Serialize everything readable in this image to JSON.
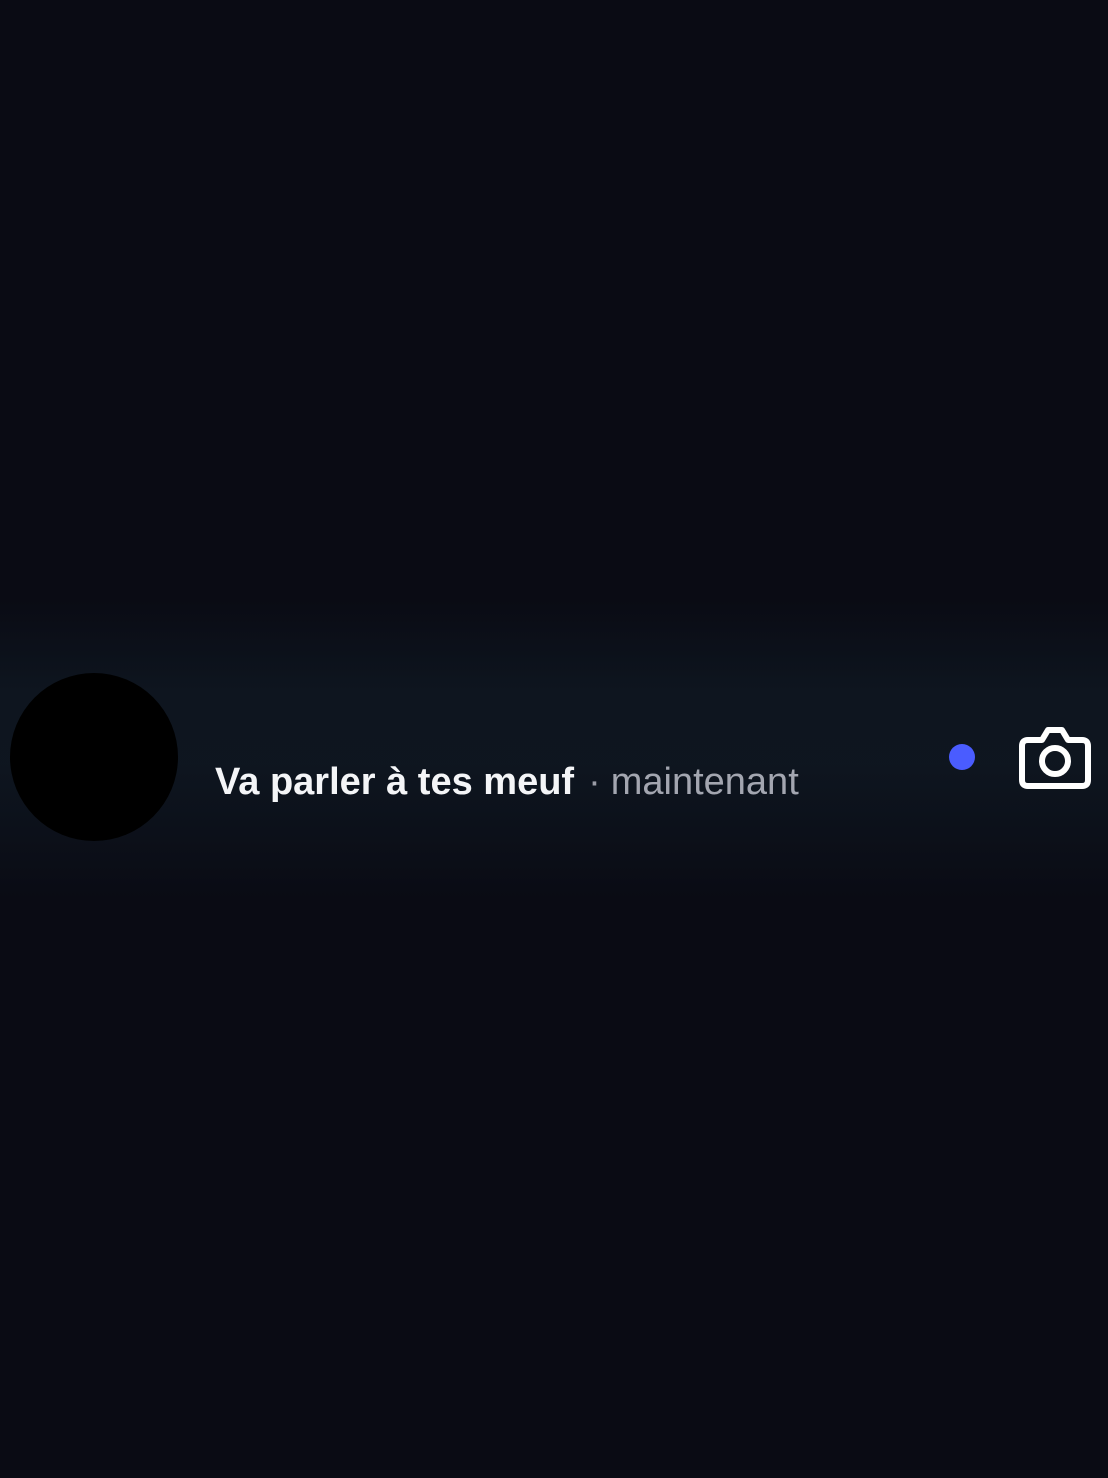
{
  "conversation": {
    "message_preview": "Va parler à tes meuf",
    "separator": "·",
    "timestamp": "maintenant",
    "unread": true,
    "camera_icon": "camera-icon"
  },
  "colors": {
    "background": "#0a0b14",
    "unread_dot": "#4a5cff",
    "primary_text": "#f4f5f7",
    "secondary_text": "#a3a6b0"
  }
}
